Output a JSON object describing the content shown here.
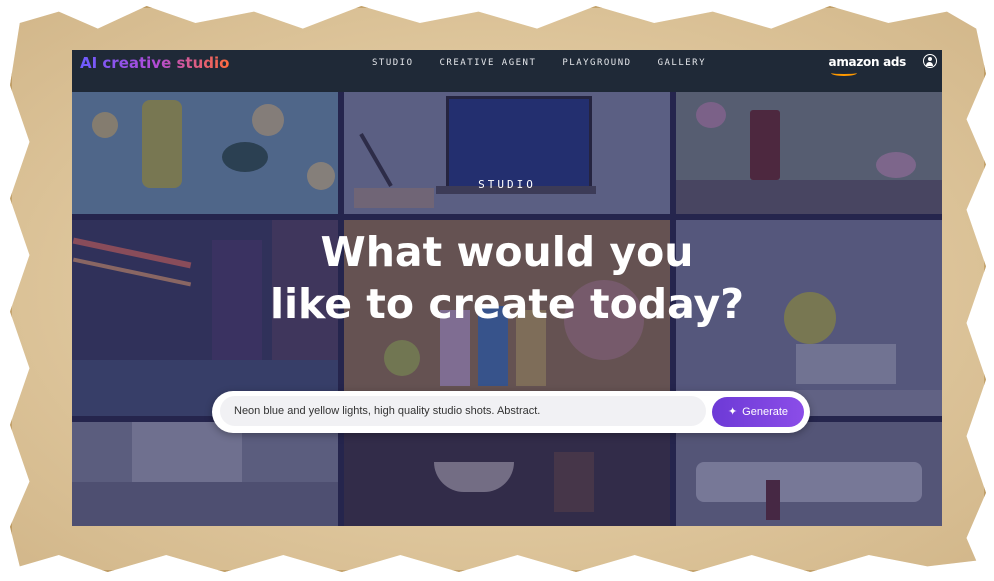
{
  "app": {
    "logo_text": "AI creative studio",
    "brand_text": "amazon ads"
  },
  "nav": {
    "items": [
      {
        "label": "STUDIO"
      },
      {
        "label": "CREATIVE AGENT"
      },
      {
        "label": "PLAYGROUND"
      },
      {
        "label": "GALLERY"
      }
    ]
  },
  "hero": {
    "eyebrow": "STUDIO",
    "headline_line1": "What would you",
    "headline_line2": "like to create today?"
  },
  "prompt": {
    "value": "Neon blue and yellow lights, high quality studio shots. Abstract.",
    "button_label": "Generate"
  },
  "icons": {
    "user": "user-circle-icon",
    "generate": "sparkle-icon"
  },
  "colors": {
    "topbar": "#1f2937",
    "accent": "#7c3aed",
    "overlay": "#28265a"
  }
}
